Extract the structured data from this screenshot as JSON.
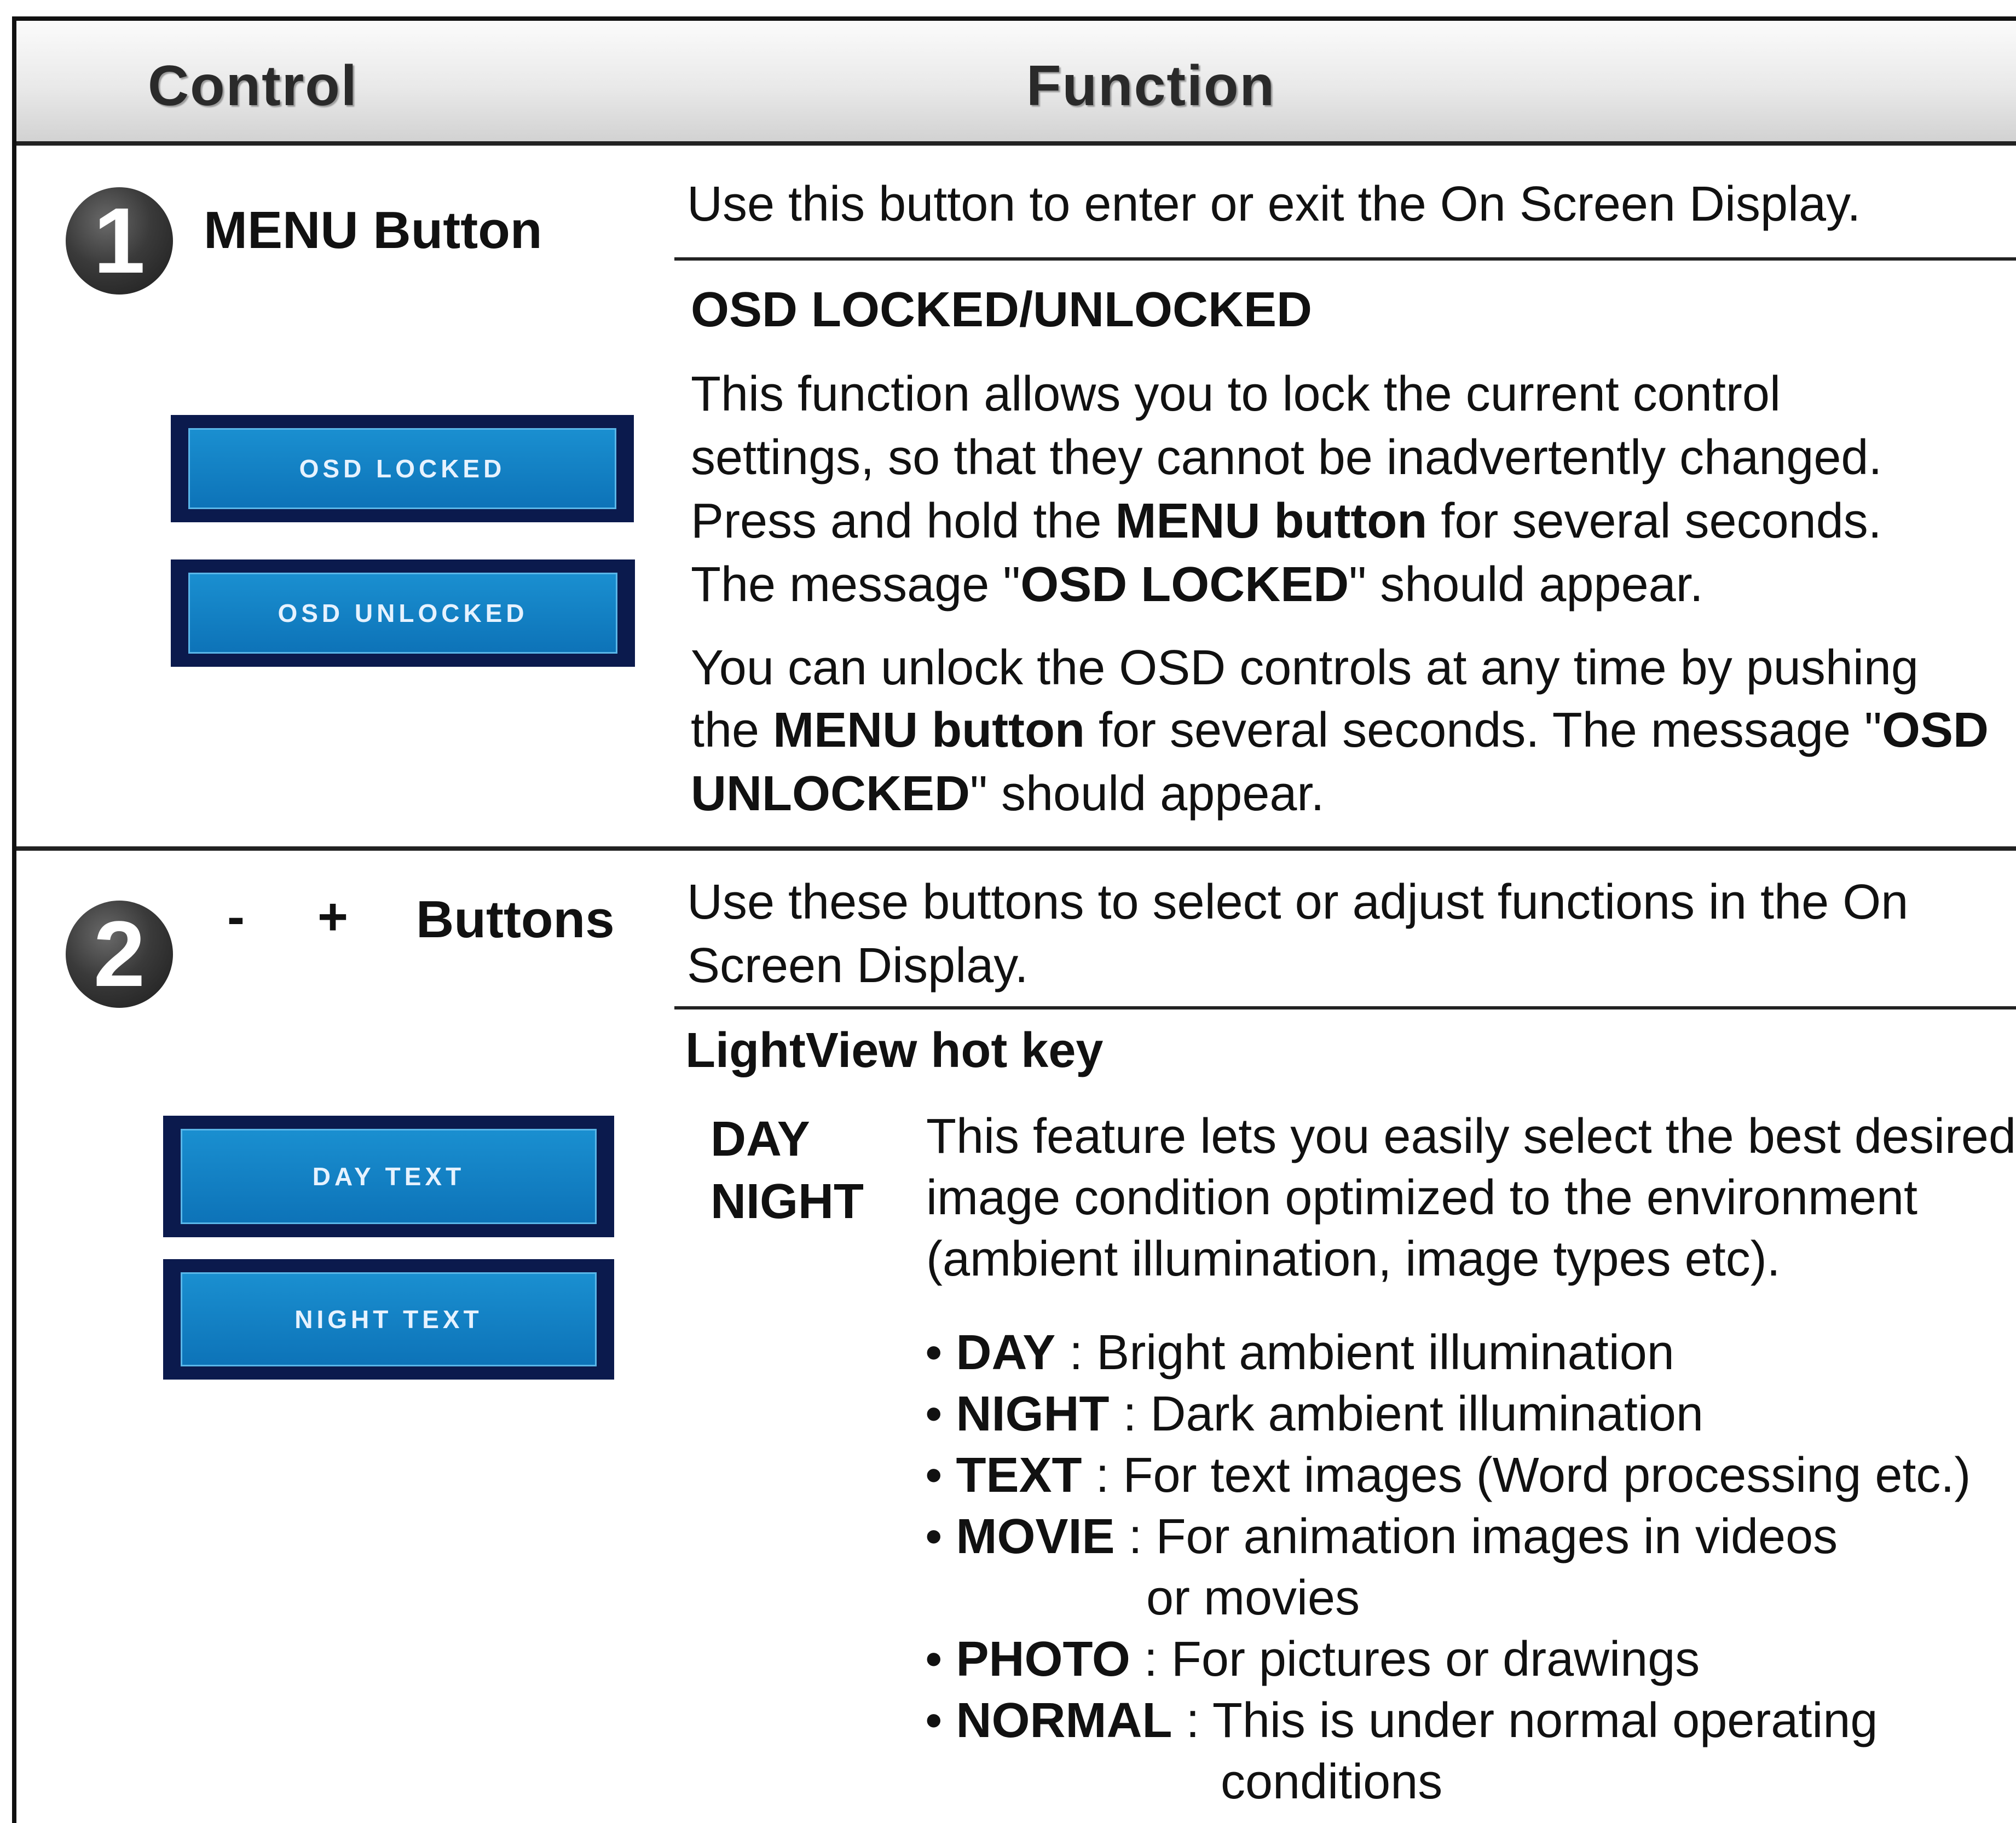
{
  "header": {
    "control": "Control",
    "function": "Function"
  },
  "menu": {
    "number": "1",
    "control_label": "MENU Button",
    "osd_locked": "OSD LOCKED",
    "osd_unlocked": "OSD UNLOCKED",
    "intro": "Use this button to enter or exit the On Screen Display.",
    "lock_title": "OSD LOCKED/UNLOCKED",
    "lock_p1_l1": "This function allows you to lock the current control",
    "lock_p1_l2": "settings, so that they cannot be inadvertently changed.",
    "lock_p1_l3_a": "Press and hold the ",
    "lock_p1_l3_b": "MENU button",
    "lock_p1_l3_c": " for several seconds.",
    "lock_p1_l4_a": "The message \"",
    "lock_p1_l4_b": "OSD LOCKED",
    "lock_p1_l4_c": "\" should appear.",
    "lock_p2_l1": "You can unlock the OSD controls at any time by pushing",
    "lock_p2_l2_a": "the ",
    "lock_p2_l2_b": "MENU button",
    "lock_p2_l2_c": " for several seconds. The message \"",
    "lock_p2_l2_d": "OSD",
    "lock_p2_l3_a": "UNLOCKED",
    "lock_p2_l3_b": "\" should appear."
  },
  "buttons": {
    "number": "2",
    "minus": "-",
    "plus": "+",
    "control_label": "Buttons",
    "day_text": "DAY TEXT",
    "night_text": "NIGHT TEXT",
    "intro_l1": "Use these buttons to select or adjust functions in the On",
    "intro_l2": "Screen Display.",
    "lightview_title": "LightView hot key",
    "day_label": "DAY",
    "night_label": "NIGHT",
    "desc_l1": "This feature lets you easily select the best desired",
    "desc_l2": "image condition optimized to the environment",
    "desc_l3": "(ambient illumination, image types etc).",
    "modes": [
      {
        "name": "DAY",
        "desc": " : Bright ambient illumination"
      },
      {
        "name": "NIGHT",
        "desc": " : Dark ambient illumination"
      },
      {
        "name": "TEXT",
        "desc": " : For text images (Word processing etc.)"
      },
      {
        "name": "MOVIE",
        "desc": " : For animation images in videos",
        "cont": "or movies"
      },
      {
        "name": "PHOTO",
        "desc": " : For pictures or drawings"
      },
      {
        "name": "NORMAL",
        "desc": " : This is under normal operating",
        "cont": "conditions"
      }
    ]
  }
}
